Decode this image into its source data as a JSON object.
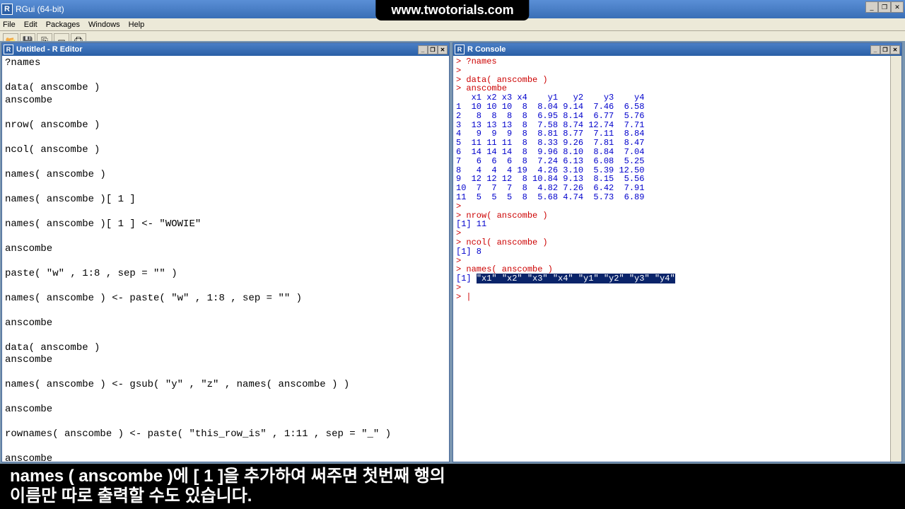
{
  "app": {
    "title": "RGui (64-bit)",
    "url_badge": "www.twotorials.com"
  },
  "menubar": [
    "File",
    "Edit",
    "Packages",
    "Windows",
    "Help"
  ],
  "editor": {
    "title": "Untitled - R Editor",
    "lines": [
      "?names",
      "",
      "data( anscombe )",
      "anscombe",
      "",
      "nrow( anscombe )",
      "",
      "ncol( anscombe )",
      "",
      "names( anscombe )",
      "",
      "names( anscombe )[ 1 ]",
      "",
      "names( anscombe )[ 1 ] <- \"WOWIE\"",
      "",
      "anscombe",
      "",
      "paste( \"w\" , 1:8 , sep = \"\" )",
      "",
      "names( anscombe ) <- paste( \"w\" , 1:8 , sep = \"\" )",
      "",
      "anscombe",
      "",
      "data( anscombe )",
      "anscombe",
      "",
      "names( anscombe ) <- gsub( \"y\" , \"z\" , names( anscombe ) )",
      "",
      "anscombe",
      "",
      "rownames( anscombe ) <- paste( \"this_row_is\" , 1:11 , sep = \"_\" )",
      "",
      "anscombe"
    ]
  },
  "console": {
    "title": "R Console",
    "lines": [
      {
        "t": "cmd",
        "s": "> ?names"
      },
      {
        "t": "cmd",
        "s": "> "
      },
      {
        "t": "cmd",
        "s": "> data( anscombe )"
      },
      {
        "t": "cmd",
        "s": "> anscombe"
      },
      {
        "t": "out",
        "s": "   x1 x2 x3 x4    y1   y2    y3    y4"
      },
      {
        "t": "out",
        "s": "1  10 10 10  8  8.04 9.14  7.46  6.58"
      },
      {
        "t": "out",
        "s": "2   8  8  8  8  6.95 8.14  6.77  5.76"
      },
      {
        "t": "out",
        "s": "3  13 13 13  8  7.58 8.74 12.74  7.71"
      },
      {
        "t": "out",
        "s": "4   9  9  9  8  8.81 8.77  7.11  8.84"
      },
      {
        "t": "out",
        "s": "5  11 11 11  8  8.33 9.26  7.81  8.47"
      },
      {
        "t": "out",
        "s": "6  14 14 14  8  9.96 8.10  8.84  7.04"
      },
      {
        "t": "out",
        "s": "7   6  6  6  8  7.24 6.13  6.08  5.25"
      },
      {
        "t": "out",
        "s": "8   4  4  4 19  4.26 3.10  5.39 12.50"
      },
      {
        "t": "out",
        "s": "9  12 12 12  8 10.84 9.13  8.15  5.56"
      },
      {
        "t": "out",
        "s": "10  7  7  7  8  4.82 7.26  6.42  7.91"
      },
      {
        "t": "out",
        "s": "11  5  5  5  8  5.68 4.74  5.73  6.89"
      },
      {
        "t": "cmd",
        "s": "> "
      },
      {
        "t": "cmd",
        "s": "> nrow( anscombe )"
      },
      {
        "t": "out",
        "s": "[1] 11"
      },
      {
        "t": "cmd",
        "s": "> "
      },
      {
        "t": "cmd",
        "s": "> ncol( anscombe )"
      },
      {
        "t": "out",
        "s": "[1] 8"
      },
      {
        "t": "cmd",
        "s": "> "
      },
      {
        "t": "cmd",
        "s": "> names( anscombe )"
      },
      {
        "t": "out",
        "s": "[1] ",
        "sel": "\"x1\" \"x2\" \"x3\" \"x4\" \"y1\" \"y2\" \"y3\" \"y4\""
      },
      {
        "t": "cmd",
        "s": "> "
      },
      {
        "t": "cmd",
        "s": "> |"
      }
    ]
  },
  "subtitle": {
    "line1": "names ( anscombe )에 [ 1 ]을 추가하여 써주면 첫번째 행의",
    "line2": "이름만 따로 출력할 수도 있습니다."
  }
}
